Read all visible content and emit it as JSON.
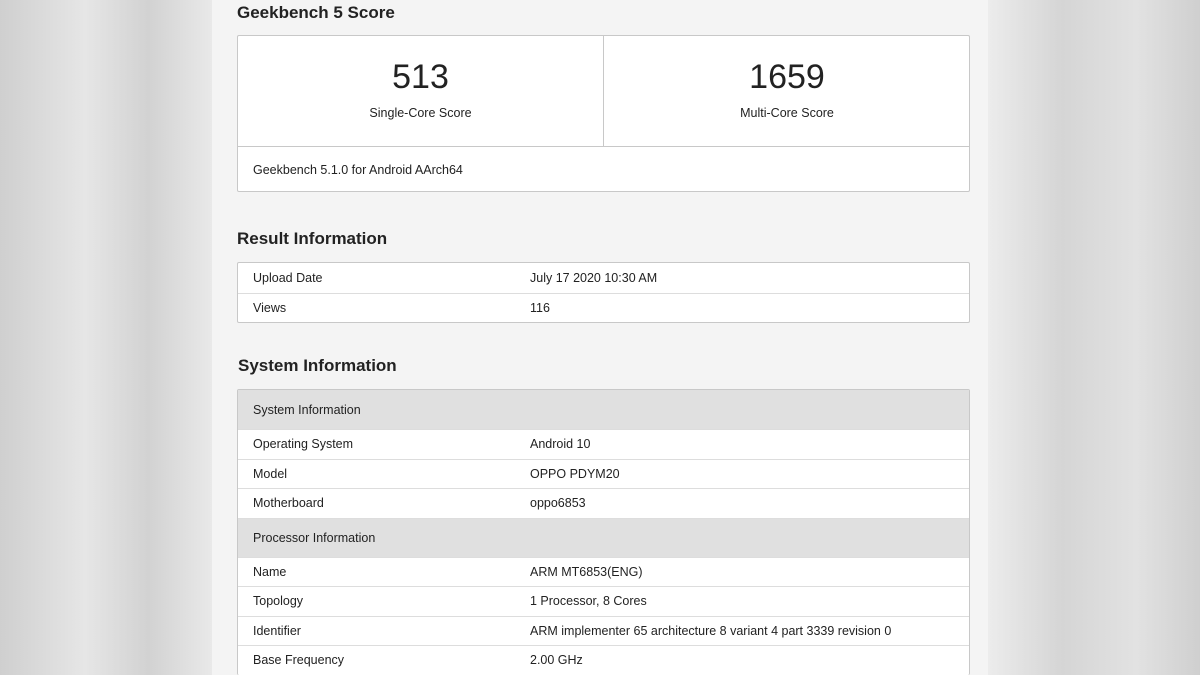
{
  "geekbench": {
    "title": "Geekbench 5 Score",
    "single_core_score": "513",
    "single_core_label": "Single-Core Score",
    "multi_core_score": "1659",
    "multi_core_label": "Multi-Core Score",
    "version": "Geekbench 5.1.0 for Android AArch64"
  },
  "result_info": {
    "title": "Result Information",
    "rows": [
      {
        "key": "Upload Date",
        "value": "July 17 2020 10:30 AM"
      },
      {
        "key": "Views",
        "value": "116"
      }
    ]
  },
  "system_info": {
    "title": "System Information",
    "system_header": "System Information",
    "system_rows": [
      {
        "key": "Operating System",
        "value": "Android 10"
      },
      {
        "key": "Model",
        "value": "OPPO PDYM20"
      },
      {
        "key": "Motherboard",
        "value": "oppo6853"
      }
    ],
    "processor_header": "Processor Information",
    "processor_rows": [
      {
        "key": "Name",
        "value": "ARM MT6853(ENG)"
      },
      {
        "key": "Topology",
        "value": "1 Processor, 8 Cores"
      },
      {
        "key": "Identifier",
        "value": "ARM implementer 65 architecture 8 variant 4 part 3339 revision 0"
      },
      {
        "key": "Base Frequency",
        "value": "2.00 GHz"
      }
    ]
  }
}
